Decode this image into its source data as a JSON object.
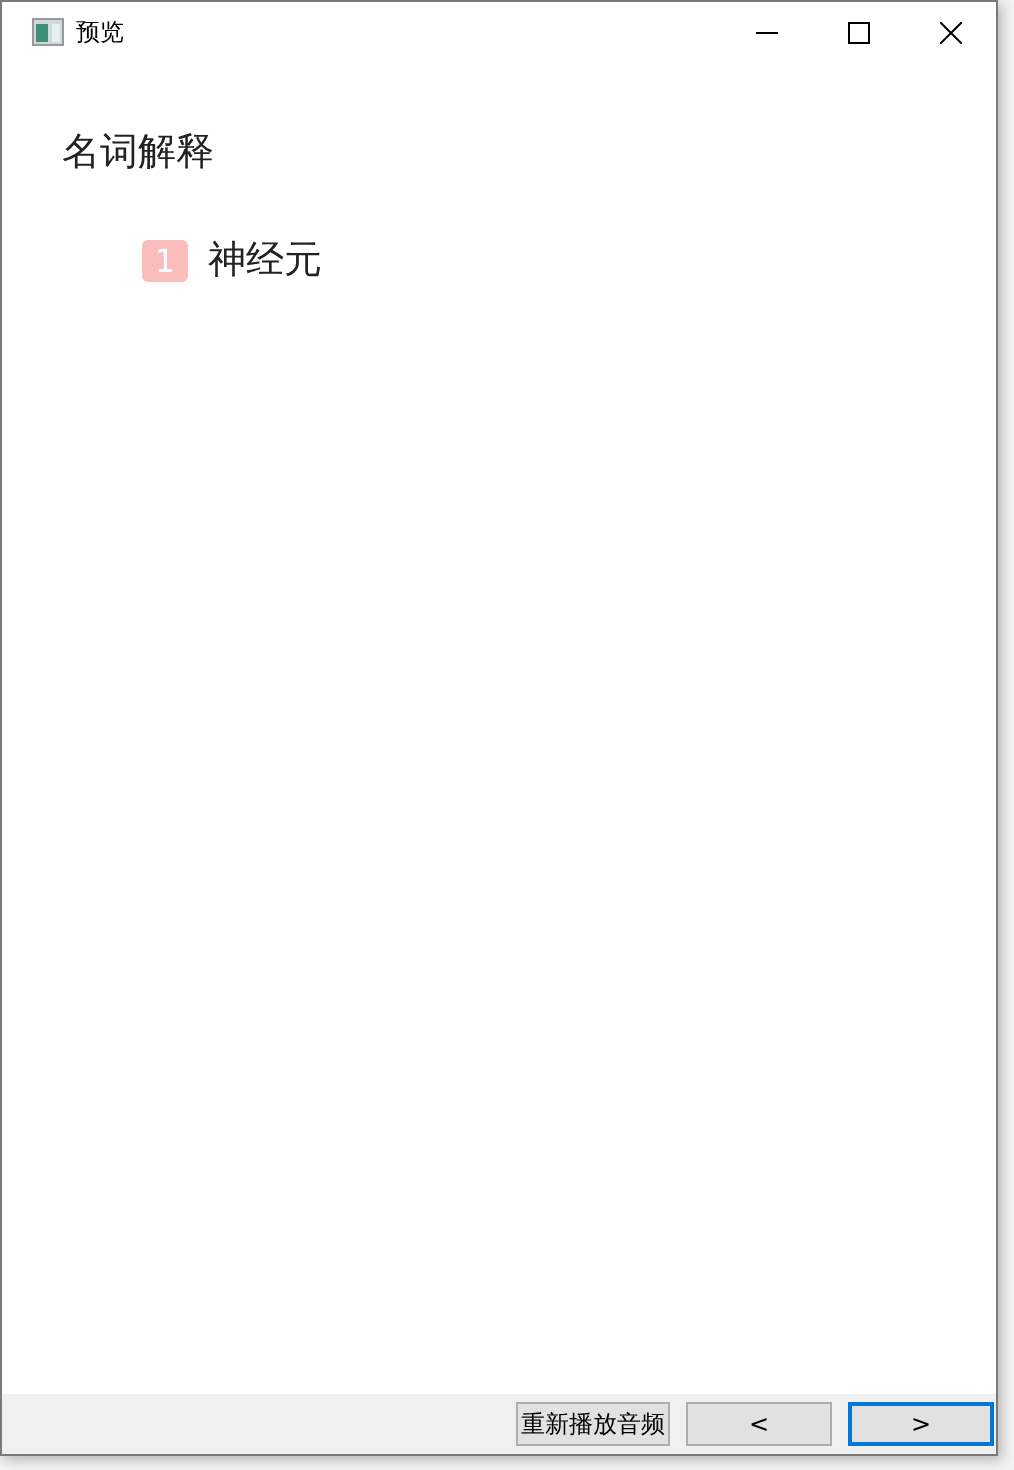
{
  "window": {
    "title": "预览"
  },
  "content": {
    "heading": "名词解释",
    "items": [
      {
        "number": "1",
        "text": "神经元"
      }
    ]
  },
  "buttons": [
    {
      "label": "重新播放音频",
      "focused": false
    },
    {
      "label": "<",
      "focused": false
    },
    {
      "label": ">",
      "focused": true
    }
  ]
}
